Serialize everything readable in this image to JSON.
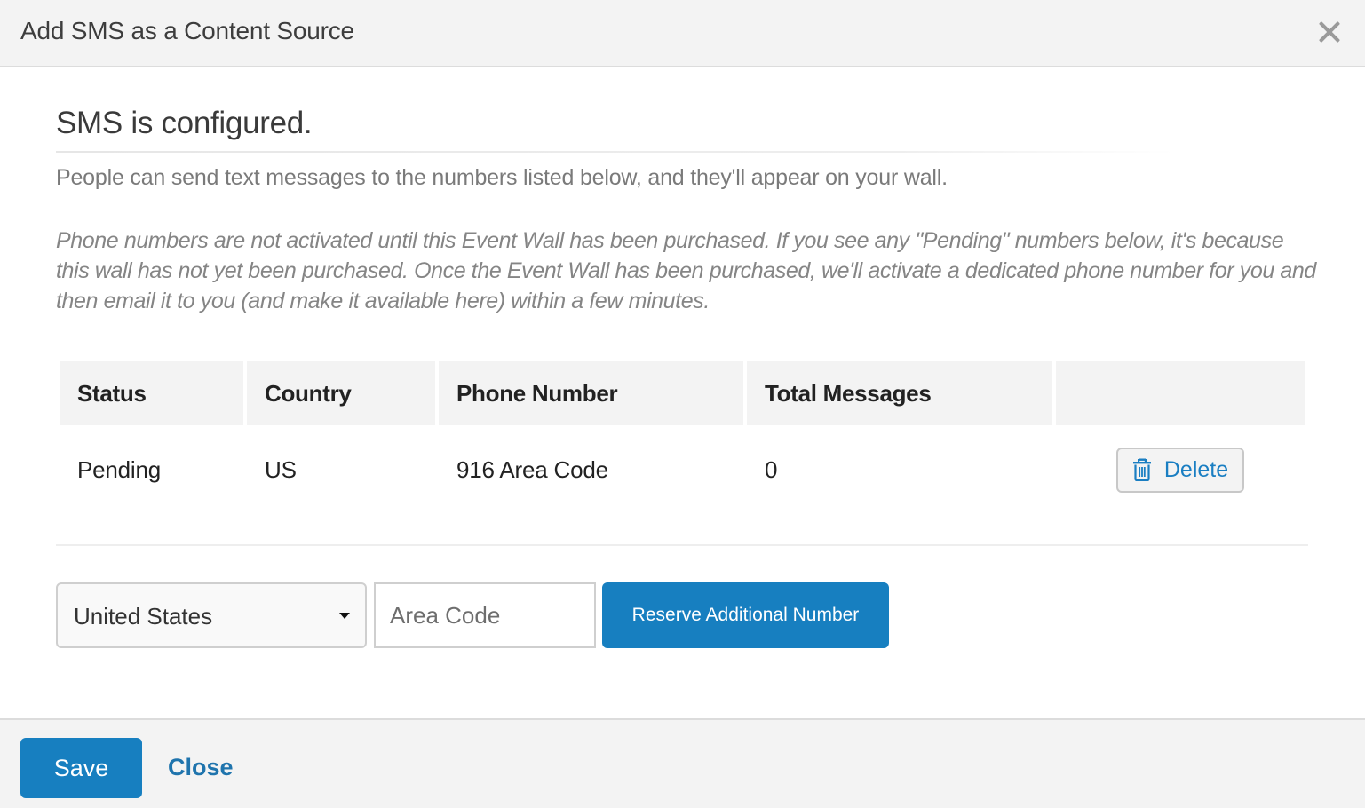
{
  "modal": {
    "title": "Add SMS as a Content Source",
    "close_icon": "close-icon"
  },
  "main": {
    "heading": "SMS is configured.",
    "intro": "People can send text messages to the numbers listed below, and they'll appear on your wall.",
    "note": "Phone numbers are not activated until this Event Wall has been purchased. If you see any \"Pending\" numbers below, it's because this wall has not yet been purchased. Once the Event Wall has been purchased, we'll activate a dedicated phone number for you and then email it to you (and make it available here) within a few minutes."
  },
  "table": {
    "headers": [
      "Status",
      "Country",
      "Phone Number",
      "Total Messages",
      ""
    ],
    "rows": [
      {
        "status": "Pending",
        "country": "US",
        "phone_number": "916 Area Code",
        "total_messages": "0",
        "action_label": "Delete",
        "action_icon": "trash-icon"
      }
    ]
  },
  "reserve_form": {
    "country_selected": "United States",
    "area_code_value": "",
    "area_code_placeholder": "Area Code",
    "reserve_label": "Reserve Additional Number"
  },
  "footer": {
    "save_label": "Save",
    "close_label": "Close"
  },
  "colors": {
    "primary": "#177fc0",
    "link": "#1f74ad",
    "header_bg": "#f3f3f3"
  }
}
